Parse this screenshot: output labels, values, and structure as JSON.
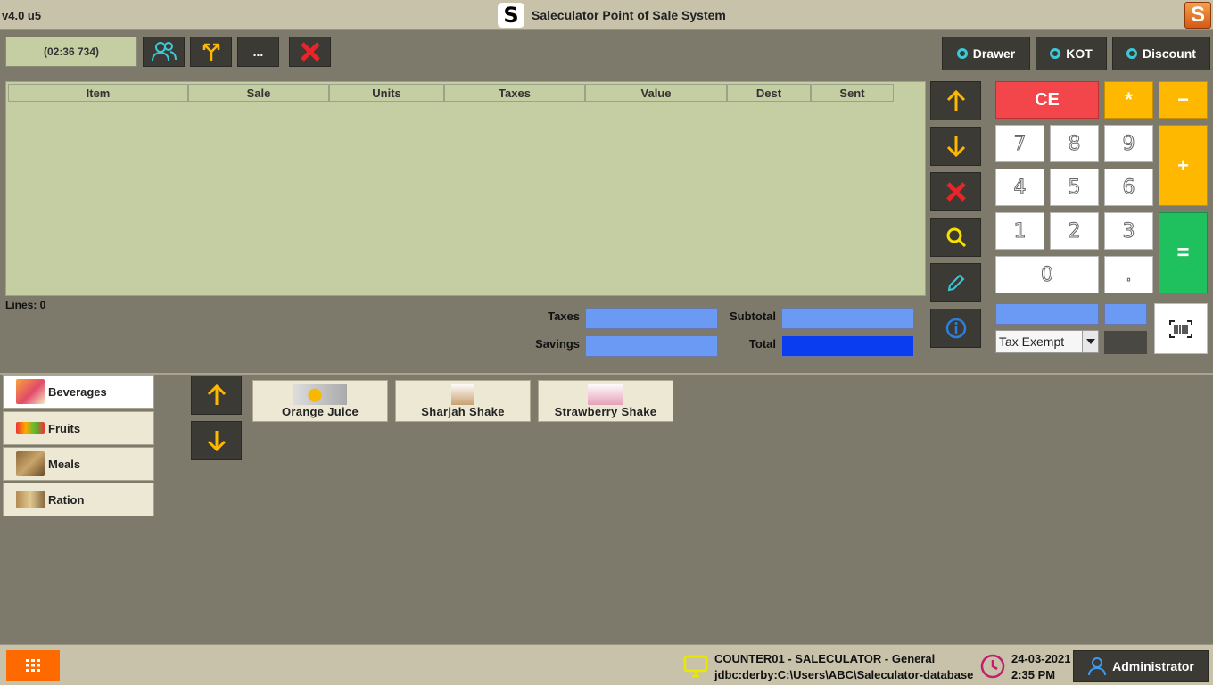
{
  "titlebar": {
    "version": "v4.0 u5",
    "logo_letter": "S",
    "title": "Saleculator Point of Sale System"
  },
  "toolbar": {
    "timer": "(02:36 734)",
    "more_label": "...",
    "drawer_label": "Drawer",
    "kot_label": "KOT",
    "discount_label": "Discount"
  },
  "ticket": {
    "columns": [
      "Item",
      "Sale",
      "Units",
      "Taxes",
      "Value",
      "Dest",
      "Sent"
    ],
    "lines_label": "Lines: 0",
    "taxes_label": "Taxes",
    "subtotal_label": "Subtotal",
    "savings_label": "Savings",
    "total_label": "Total"
  },
  "keypad": {
    "ce": "CE",
    "multiply": "*",
    "minus": "−",
    "plus": "+",
    "equals": "=",
    "digits": [
      "7",
      "8",
      "9",
      "4",
      "5",
      "6",
      "1",
      "2",
      "3",
      "0",
      "."
    ],
    "tax_option": "Tax Exempt"
  },
  "categories": [
    {
      "label": "Beverages",
      "active": true
    },
    {
      "label": "Fruits"
    },
    {
      "label": "Meals"
    },
    {
      "label": "Ration"
    }
  ],
  "products": [
    {
      "label": "Orange Juice"
    },
    {
      "label": "Sharjah Shake"
    },
    {
      "label": "Strawberry Shake"
    }
  ],
  "statusbar": {
    "host": "COUNTER01 - SALECULATOR - General",
    "db": "jdbc:derby:C:\\Users\\ABC\\Saleculator-database",
    "date": "24-03-2021",
    "time": "2:35 PM",
    "user": "Administrator"
  },
  "colors": {
    "accent_yellow": "#ffb800",
    "accent_red": "#f2464a",
    "accent_green": "#1ec15e",
    "field_blue": "#6b9af4",
    "total_blue": "#0a3cf0",
    "menu_orange": "#ff6a00"
  }
}
